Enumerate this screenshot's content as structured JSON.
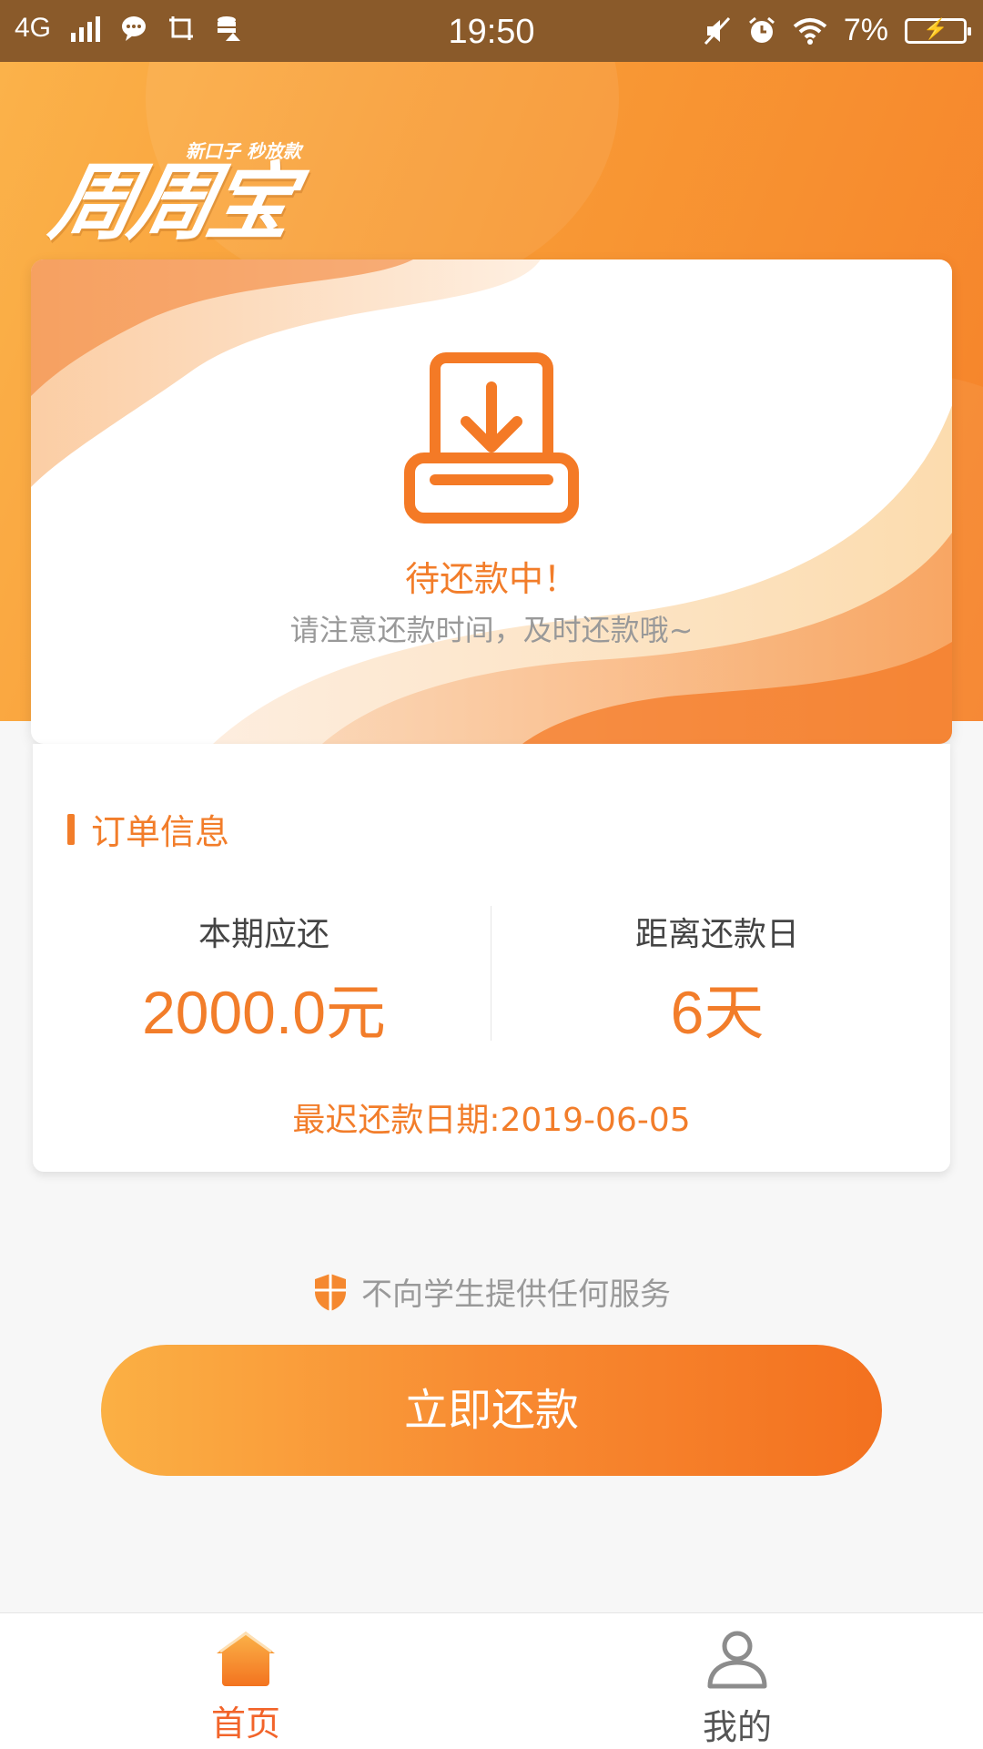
{
  "status_bar": {
    "network": "4G",
    "time": "19:50",
    "battery": "7%"
  },
  "header": {
    "logo_text": "周周宝",
    "logo_tagline": "新口子 秒放款"
  },
  "status_card": {
    "title": "待还款中！",
    "subtitle": "请注意还款时间，及时还款哦~",
    "icon": "download-document-icon"
  },
  "order_info": {
    "section_title": "订单信息",
    "amount_label": "本期应还",
    "amount_value": "2000.0元",
    "days_label": "距离还款日",
    "days_value": "6天",
    "due_date": "最迟还款日期:2019-06-05"
  },
  "notice": {
    "text": "不向学生提供任何服务",
    "icon": "shield-icon"
  },
  "actions": {
    "pay_label": "立即还款"
  },
  "bottom_nav": {
    "items": [
      {
        "label": "首页",
        "icon": "home-icon",
        "active": true
      },
      {
        "label": "我的",
        "icon": "user-icon",
        "active": false
      }
    ]
  },
  "colors": {
    "accent": "#f27d2a",
    "status_bar": "#8a5a2a",
    "header_start": "#fbb24a",
    "header_end": "#f6822a",
    "nav_active": "#f2642a"
  }
}
